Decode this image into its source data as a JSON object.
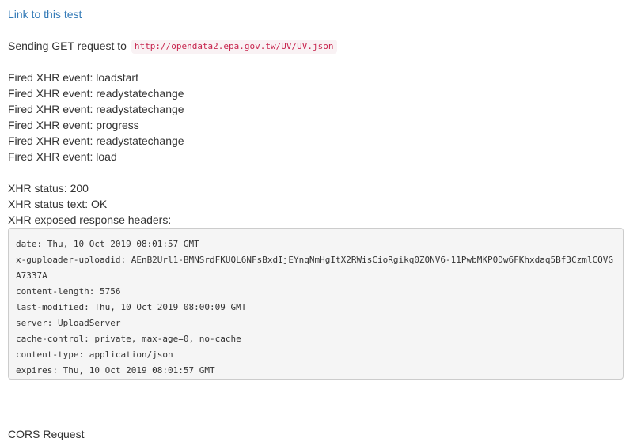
{
  "link_text": "Link to this test",
  "sending": {
    "prefix": "Sending GET request to",
    "url": "http://opendata2.epa.gov.tw/UV/UV.json"
  },
  "events": [
    "Fired XHR event: loadstart",
    "Fired XHR event: readystatechange",
    "Fired XHR event: readystatechange",
    "Fired XHR event: progress",
    "Fired XHR event: readystatechange",
    "Fired XHR event: load"
  ],
  "status": {
    "code_line": "XHR status: 200",
    "text_line": "XHR status text: OK",
    "headers_label": "XHR exposed response headers:"
  },
  "headers": [
    "date: Thu, 10 Oct 2019 08:01:57 GMT",
    "x-guploader-uploadid: AEnB2Url1-BMNSrdFKUQL6NFsBxdIjEYnqNmHgItX2RWisCioRgikq0Z0NV6-11PwbMKP0Dw6FKhxdaq5Bf3CzmlCQVGA7337A",
    "content-length: 5756",
    "last-modified: Thu, 10 Oct 2019 08:00:09 GMT",
    "server: UploadServer",
    "cache-control: private, max-age=0, no-cache",
    "content-type: application/json",
    "expires: Thu, 10 Oct 2019 08:01:57 GMT"
  ],
  "cors_label": "CORS Request",
  "colors": {
    "link": "#337ab7",
    "code_text": "#c7254e",
    "code_bg": "#f9f2f4",
    "pre_bg": "#f5f5f5"
  }
}
